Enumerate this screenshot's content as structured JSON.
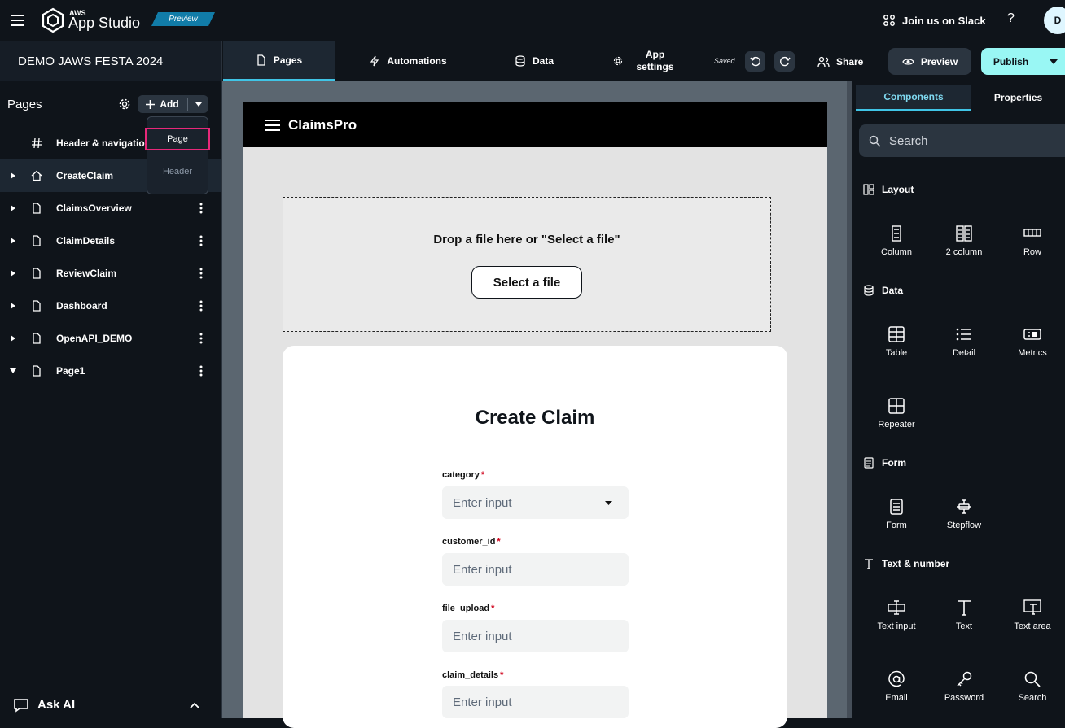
{
  "topbar": {
    "brand_small": "AWS",
    "brand_name": "App Studio",
    "badge": "Preview",
    "slack": "Join us on Slack",
    "help": "?",
    "avatar": "D"
  },
  "app": {
    "name": "DEMO JAWS FESTA 2024"
  },
  "tabs": [
    {
      "label": "Pages",
      "icon": "page-icon"
    },
    {
      "label": "Automations",
      "icon": "bolt-icon"
    },
    {
      "label": "Data",
      "icon": "database-icon"
    },
    {
      "label": "App settings",
      "icon": "gear-icon"
    }
  ],
  "toolbar": {
    "saved": "Saved",
    "share": "Share",
    "preview": "Preview",
    "publish": "Publish"
  },
  "left": {
    "title": "Pages",
    "add": "Add",
    "popup": {
      "page": "Page",
      "header": "Header"
    },
    "items": [
      {
        "label": "Header & navigation",
        "icon": "hash-icon"
      },
      {
        "label": "CreateClaim",
        "icon": "home-icon"
      },
      {
        "label": "ClaimsOverview",
        "icon": "page-icon"
      },
      {
        "label": "ClaimDetails",
        "icon": "page-icon"
      },
      {
        "label": "ReviewClaim",
        "icon": "page-icon"
      },
      {
        "label": "Dashboard",
        "icon": "page-icon"
      },
      {
        "label": "OpenAPI_DEMO",
        "icon": "page-icon"
      },
      {
        "label": "Page1",
        "icon": "page-icon"
      }
    ],
    "ask_ai": "Ask AI"
  },
  "canvas": {
    "app_title": "ClaimsPro",
    "drop_text": "Drop a file here or \"Select a file\"",
    "select_file": "Select a file",
    "form_title": "Create Claim",
    "fields": [
      {
        "label": "category",
        "placeholder": "Enter input"
      },
      {
        "label": "customer_id",
        "placeholder": "Enter input"
      },
      {
        "label": "file_upload",
        "placeholder": "Enter input"
      },
      {
        "label": "claim_details",
        "placeholder": "Enter input"
      }
    ]
  },
  "right": {
    "tabs": [
      "Components",
      "Properties"
    ],
    "search": "Search",
    "sections": [
      {
        "title": "Layout",
        "items": [
          "Column",
          "2 column",
          "Row"
        ]
      },
      {
        "title": "Data",
        "items": [
          "Table",
          "Detail",
          "Metrics",
          "Repeater"
        ]
      },
      {
        "title": "Form",
        "items": [
          "Form",
          "Stepflow"
        ]
      },
      {
        "title": "Text & number",
        "items": [
          "Text input",
          "Text",
          "Text area",
          "Email",
          "Password",
          "Search"
        ]
      }
    ]
  },
  "colors": {
    "accent": "#40c4e6",
    "publish": "#99f7f4",
    "highlight": "#e8287a"
  }
}
